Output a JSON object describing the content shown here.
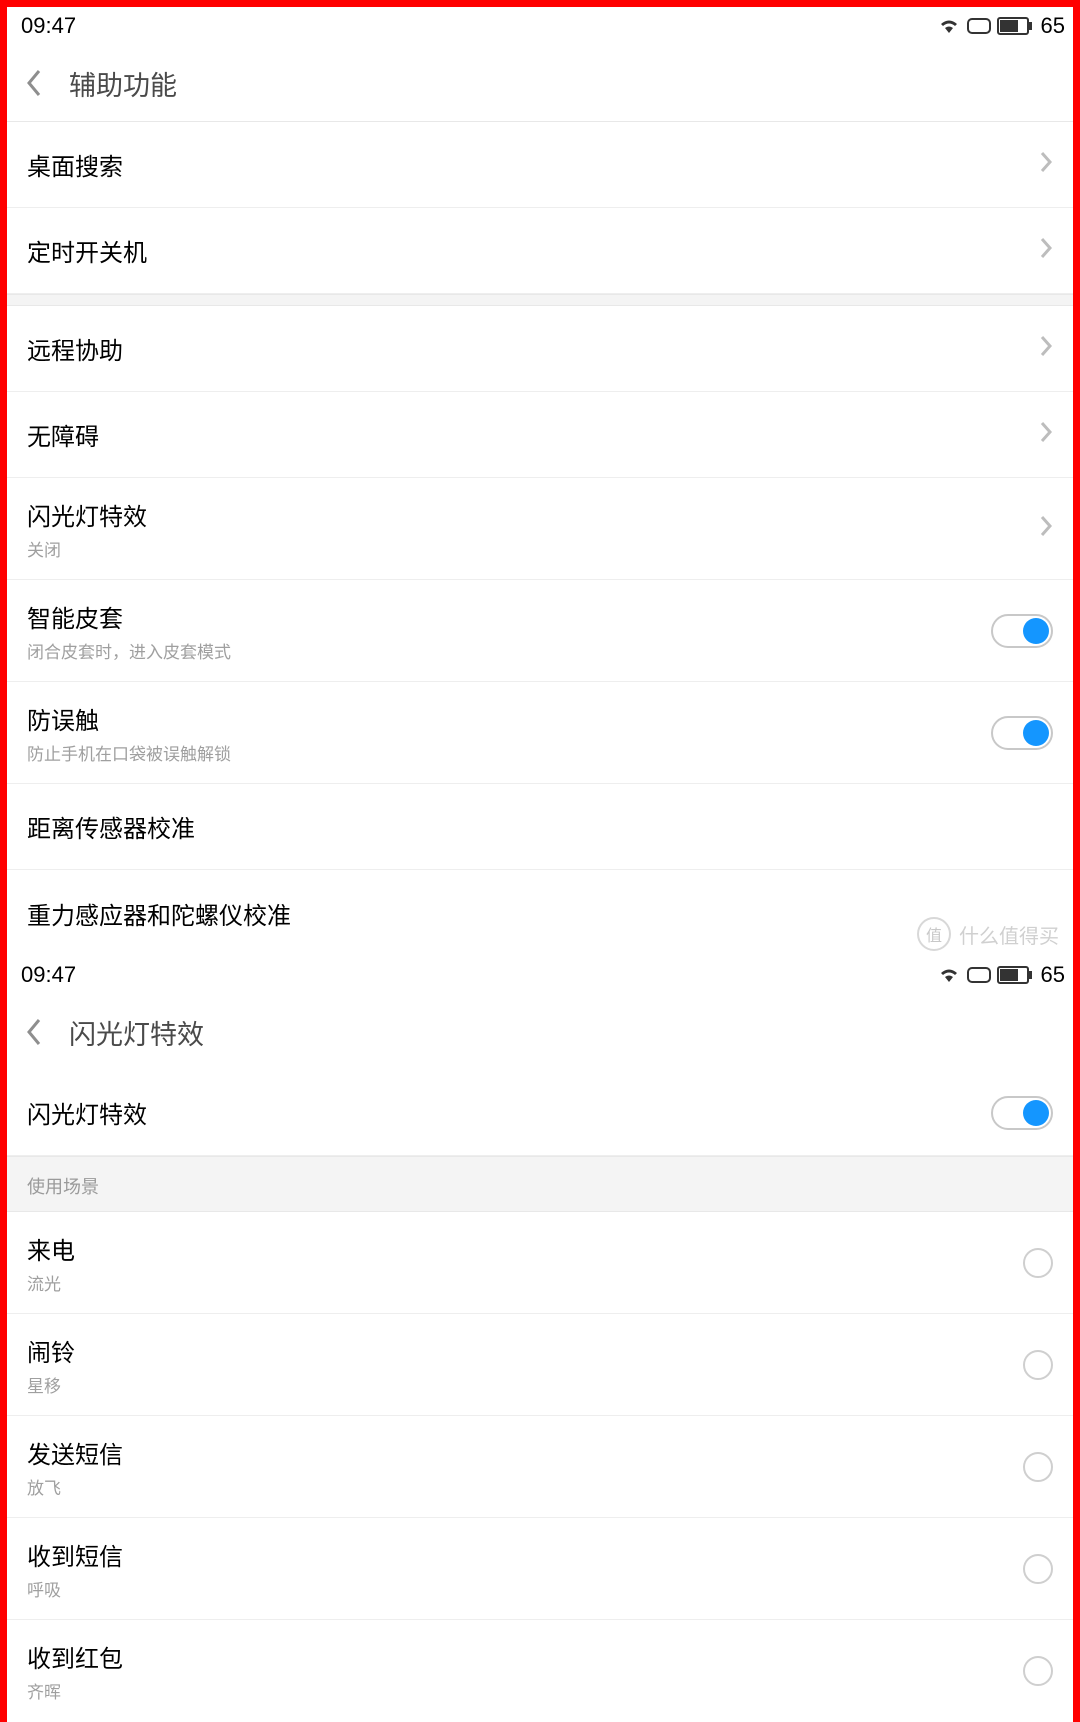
{
  "status": {
    "time": "09:47",
    "battery": "65"
  },
  "left": {
    "title": "辅助功能",
    "rows": {
      "desktop_search": "桌面搜索",
      "scheduled_power": "定时开关机",
      "remote_assist": "远程协助",
      "accessibility": "无障碍",
      "flash_effect": {
        "title": "闪光灯特效",
        "sub": "关闭"
      },
      "smart_cover": {
        "title": "智能皮套",
        "sub": "闭合皮套时，进入皮套模式"
      },
      "pocket_mode": {
        "title": "防误触",
        "sub": "防止手机在口袋被误触解锁"
      },
      "proximity_cal": "距离传感器校准",
      "gyro_cal": "重力感应器和陀螺仪校准"
    }
  },
  "right": {
    "title": "闪光灯特效",
    "master": "闪光灯特效",
    "section": "使用场景",
    "rows": {
      "incoming": {
        "title": "来电",
        "sub": "流光"
      },
      "alarm": {
        "title": "闹铃",
        "sub": "星移"
      },
      "send_sms": {
        "title": "发送短信",
        "sub": "放飞"
      },
      "recv_sms": {
        "title": "收到短信",
        "sub": "呼吸"
      },
      "red_packet": {
        "title": "收到红包",
        "sub": "齐晖"
      }
    }
  },
  "watermark": {
    "badge": "值",
    "text": "什么值得买"
  }
}
